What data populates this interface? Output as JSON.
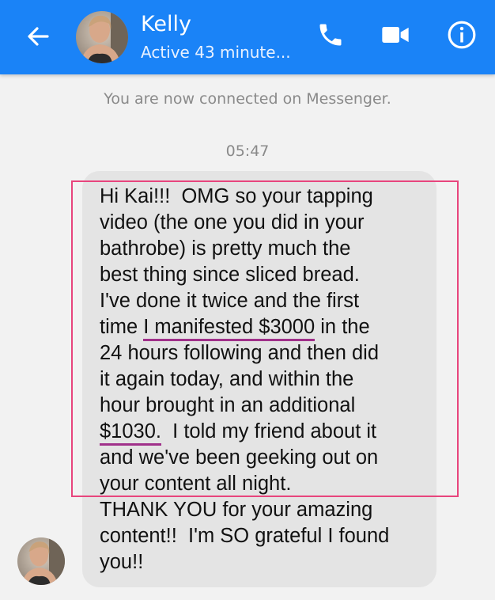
{
  "header": {
    "contact_name": "Kelly",
    "status": "Active 43 minute...",
    "accent_color": "#1a83f7",
    "icons": [
      "back-arrow-icon",
      "phone-icon",
      "video-camera-icon",
      "info-icon"
    ]
  },
  "chat": {
    "system_message": "You are now connected on Messenger.",
    "timestamp": "05:47",
    "message_lines": [
      "Hi Kai!!!  OMG so your tapping",
      "video (the one you did in your",
      "bathrobe) is pretty much the",
      "best thing since sliced bread.",
      "I've done it twice and the first",
      "time ",
      "I manifested $3000",
      " in the",
      "24 hours following and then did",
      "it again today, and within the",
      "hour brought in an additional",
      "$1030.",
      "  I told my friend about it",
      "and we've been geeking out on",
      "your content all night.",
      "THANK YOU for your amazing",
      "content!!  I'm SO grateful I found",
      "you!!"
    ],
    "bubble_color": "#e4e4e4",
    "highlight_box_color": "#e8457d",
    "underline_color": "#a0308a"
  }
}
